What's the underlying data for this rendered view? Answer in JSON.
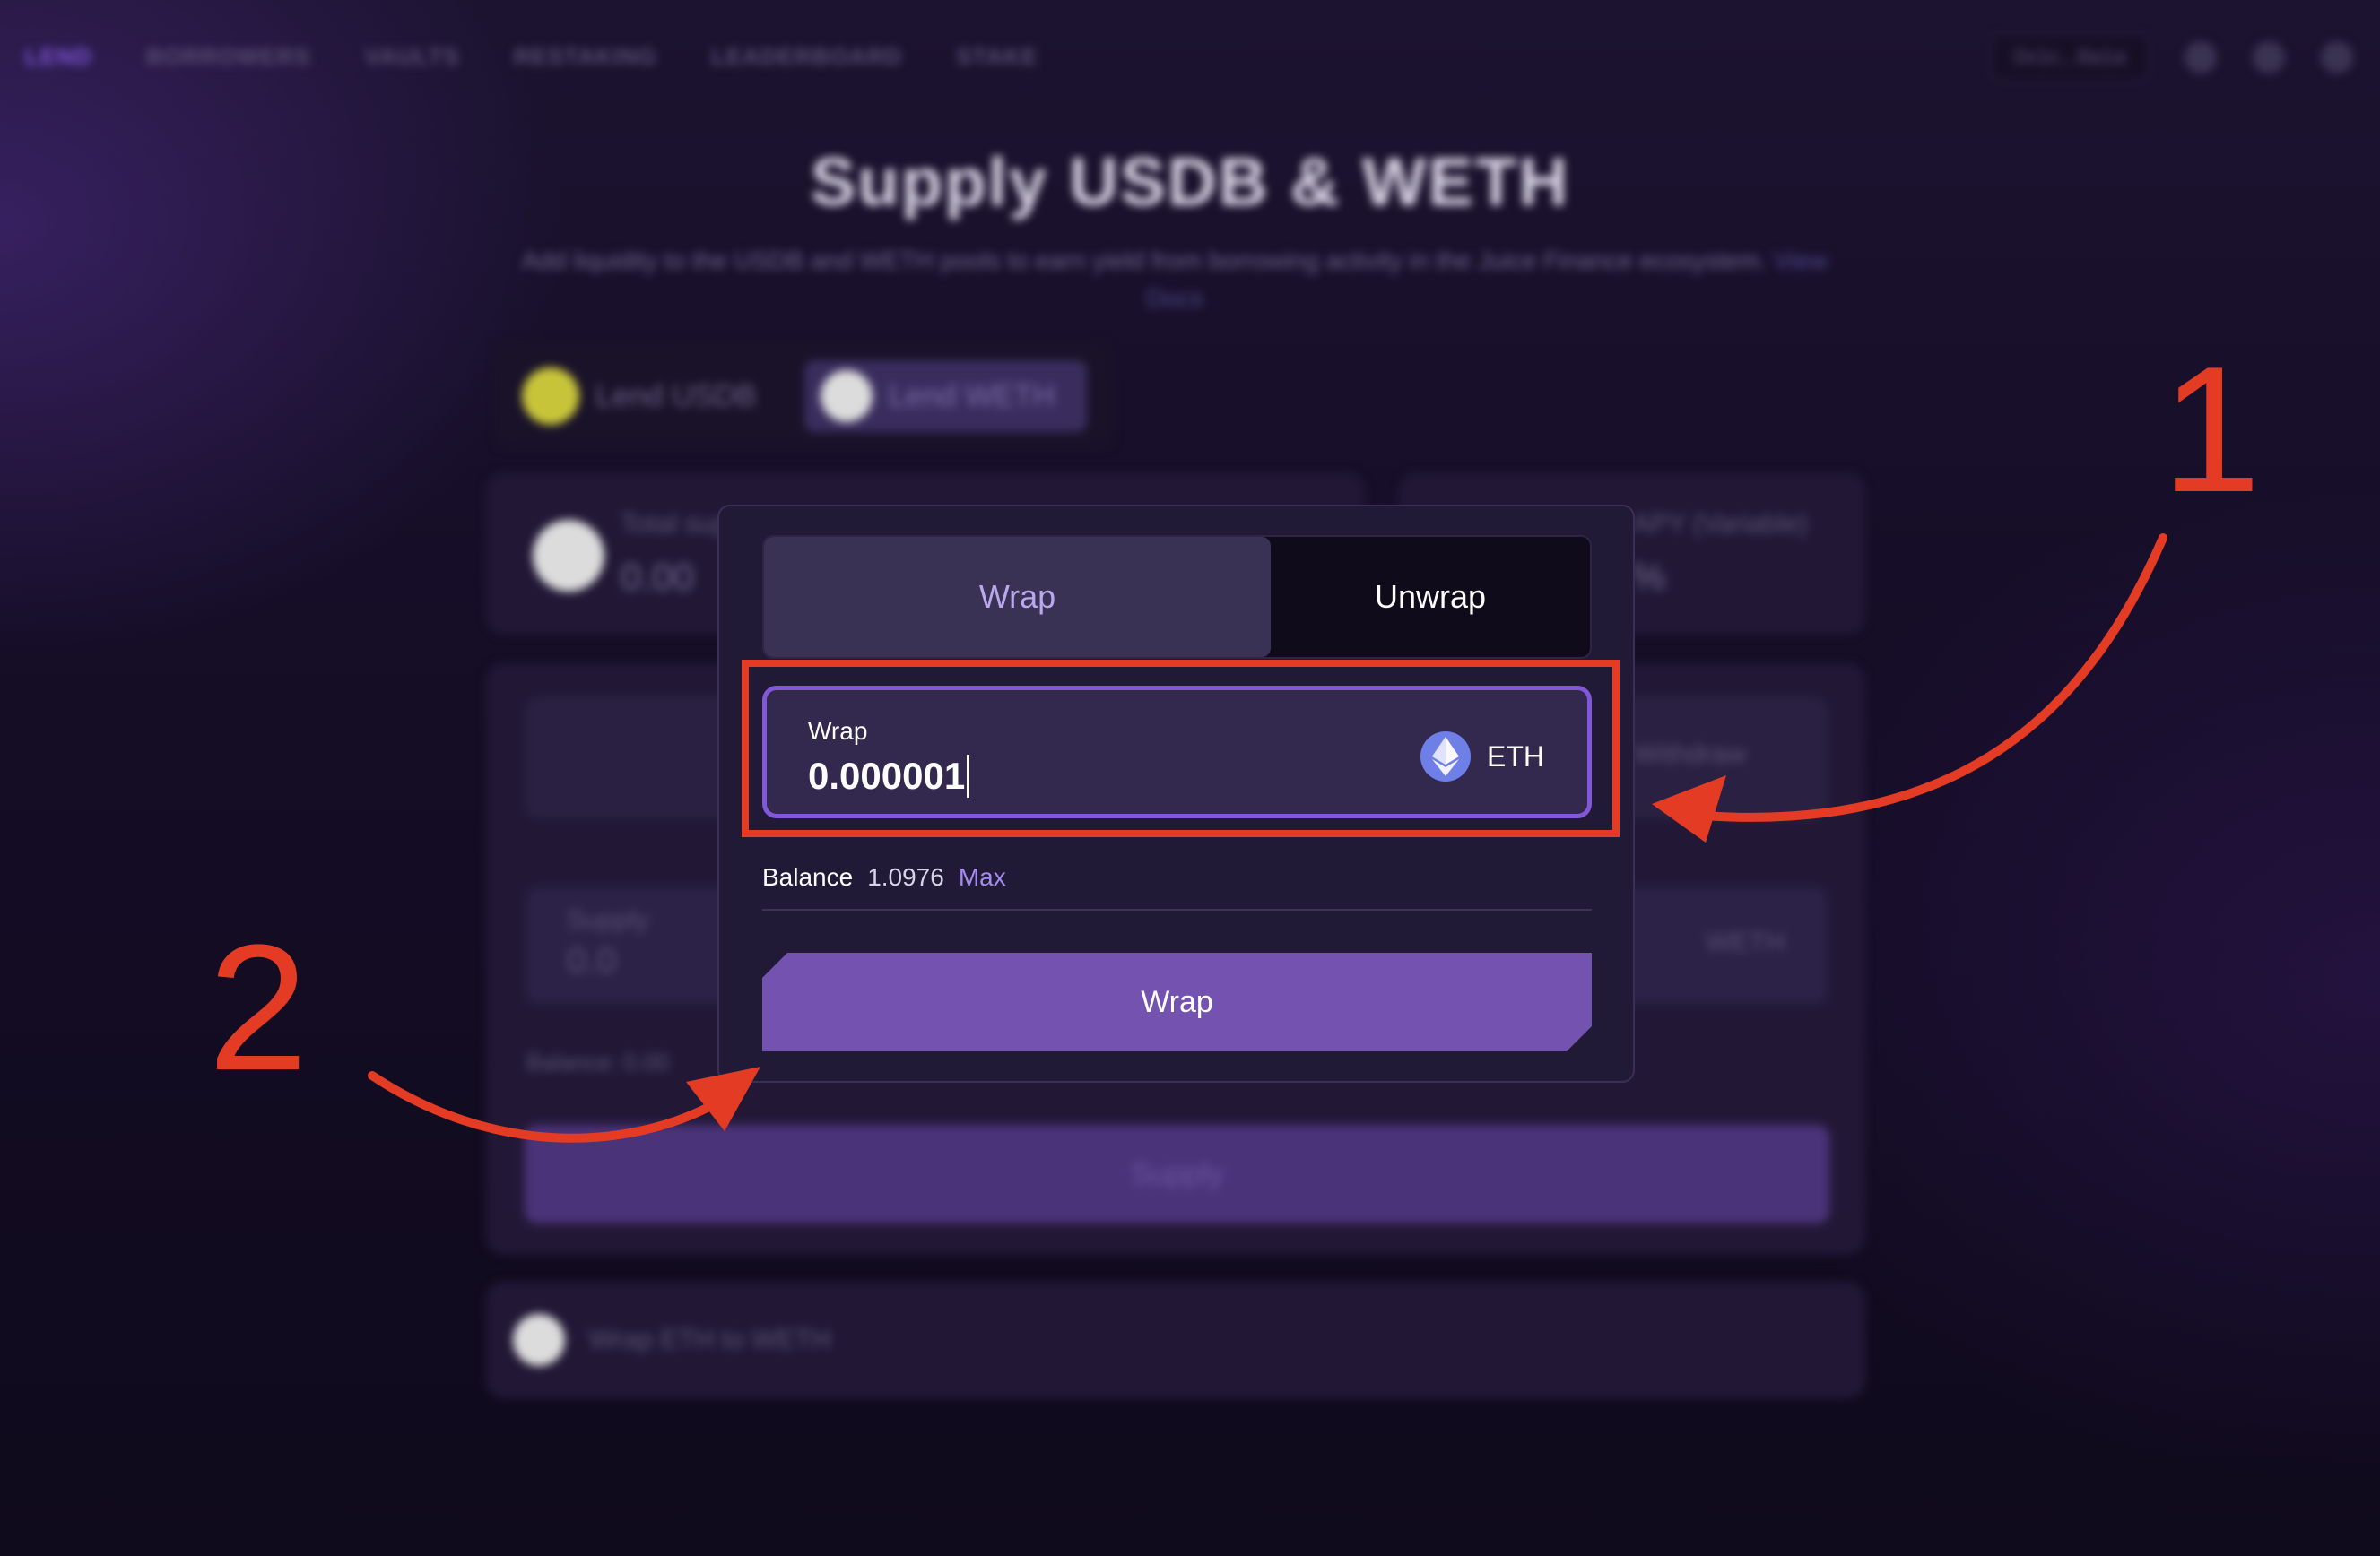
{
  "background": {
    "nav": [
      "LEND",
      "BORROWERS",
      "VAULTS",
      "RESTAKING",
      "LEADERBOARD",
      "STAKE"
    ],
    "wallet_pill": "0x1c...8a1a",
    "title": "Supply USDB & WETH",
    "subtitle": "Add liquidity to the USDB and WETH pools to earn yield from borrowing activity in the Juice Finance ecosystem.",
    "subtitle_link": "View Docs",
    "lend_tabs": [
      "Lend USDB",
      "Lend WETH"
    ],
    "stat_label": "Total supplied",
    "stat_value": "0.00",
    "apy_label": "APY (Variable)",
    "apy_value": "%",
    "withdraw_tab": "Withdraw",
    "supply_label": "Supply",
    "supply_value": "0.0",
    "supply_token": "WETH",
    "balance_ghost": "Balance: 0.00",
    "supply_button": "Supply",
    "wrap_row": "Wrap ETH to WETH"
  },
  "modal": {
    "tabs": {
      "wrap": "Wrap",
      "unwrap": "Unwrap"
    },
    "input": {
      "label": "Wrap",
      "value": "0.000001",
      "token": "ETH",
      "token_icon": "ethereum-icon"
    },
    "balance": {
      "label": "Balance",
      "value": "1.0976",
      "max": "Max"
    },
    "button": "Wrap"
  },
  "annotations": {
    "one": "1",
    "two": "2",
    "color": "#e43b25"
  },
  "colors": {
    "accent": "#8257d8",
    "button": "#7352b0",
    "background": "#120b22"
  }
}
